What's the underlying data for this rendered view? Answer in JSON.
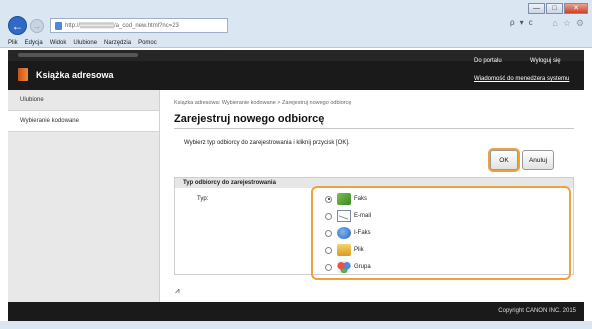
{
  "browser": {
    "window_controls": [
      "—",
      "□",
      "✕"
    ],
    "url": "http://▒▒▒▒▒▒▒▒/a_cod_new.html?nc=23",
    "address_tools": [
      "ρ",
      "▾",
      "c"
    ],
    "menu": [
      "Plik",
      "Edycja",
      "Widok",
      "Ulubione",
      "Narzędzia",
      "Pomoc"
    ],
    "icons": [
      "back-arrow-icon",
      "forward-arrow-icon",
      "page-icon",
      "search-icon",
      "refresh-icon",
      "home-icon",
      "favorites-star-icon",
      "settings-gear-icon"
    ]
  },
  "header": {
    "title": "Książka adresowa",
    "portal_link": "Do portalu",
    "logout_link": "Wyloguj się",
    "admin_message": "Wiadomość do menedżera systemu",
    "colors": {
      "background": "#1a1a1a",
      "text": "#ffffff"
    }
  },
  "sidebar": {
    "items": [
      {
        "label": "Ulubione",
        "active": false
      },
      {
        "label": "Wybieranie kodowane",
        "active": true
      }
    ]
  },
  "main": {
    "breadcrumb": "Książka adresowa: Wybieranie kodowane > Zarejestruj nowego odbiorcę",
    "title": "Zarejestruj nowego odbiorcę",
    "instructions": "Wybierz typ odbiorcy do zarejestrowania i kliknij przycisk [OK].",
    "ok_label": "OK",
    "cancel_label": "Anuluj",
    "section_title": "Typ odbiorcy do zarejestrowania",
    "type_label": "Typ:",
    "options": [
      {
        "label": "Faks",
        "checked": true,
        "icon": "fax-icon"
      },
      {
        "label": "E-mail",
        "checked": false,
        "icon": "email-icon"
      },
      {
        "label": "I-Faks",
        "checked": false,
        "icon": "ifax-icon"
      },
      {
        "label": "Plik",
        "checked": false,
        "icon": "file-icon"
      },
      {
        "label": "Grupa",
        "checked": false,
        "icon": "group-icon"
      }
    ],
    "scroll_top_glyph": "⩘",
    "highlight_color": "#f1a13a"
  },
  "footer": {
    "copyright": "Copyright CANON INC. 2015"
  }
}
